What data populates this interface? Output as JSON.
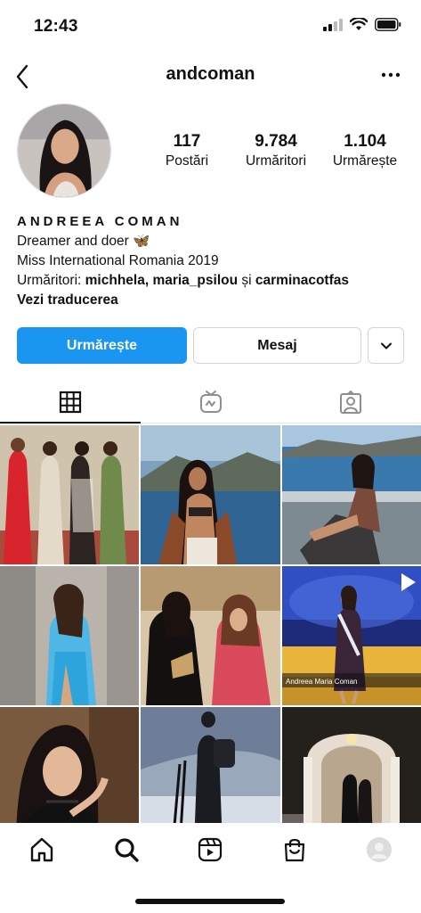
{
  "status_bar": {
    "time": "12:43"
  },
  "header": {
    "username": "andcoman"
  },
  "profile": {
    "stats": [
      {
        "value": "117",
        "label": "Postări"
      },
      {
        "value": "9.784",
        "label": "Urmăritori"
      },
      {
        "value": "1.104",
        "label": "Urmărește"
      }
    ],
    "name": "ANDREEA COMAN",
    "bio_line1": "Dreamer and doer 🦋",
    "bio_line2": "Miss International Romania 2019",
    "followers_prefix": "Urmăritori: ",
    "followers_names": "michhela, maria_psilou",
    "followers_and": " și ",
    "followers_last": "carminacotfas",
    "translate": "Vezi traducerea"
  },
  "actions": {
    "follow": "Urmărește",
    "message": "Mesaj"
  },
  "grid": {
    "overlay_caption": "Andreea Maria Coman"
  },
  "colors": {
    "accent": "#1a96f0"
  }
}
